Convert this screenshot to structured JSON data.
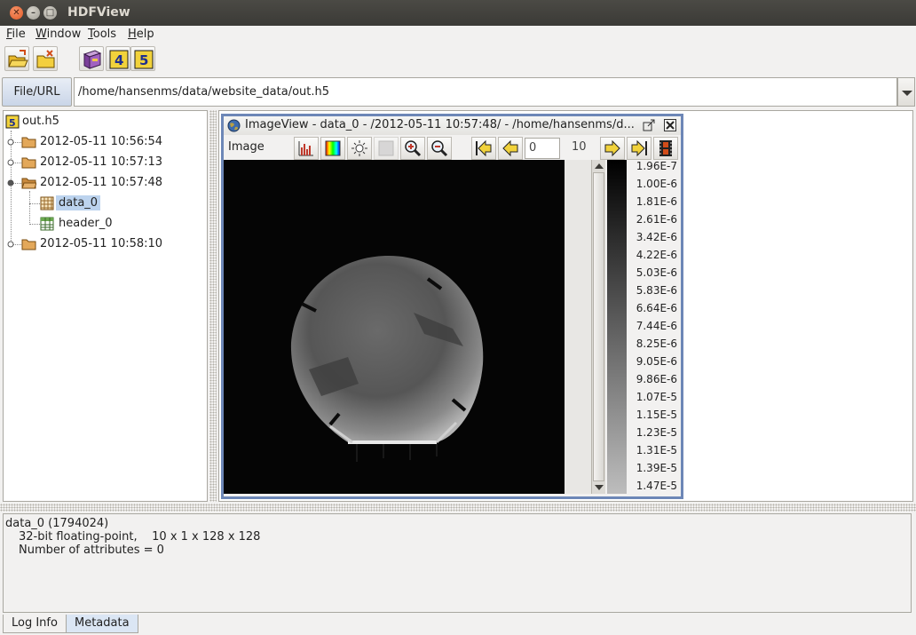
{
  "window": {
    "title": "HDFView"
  },
  "menu": [
    {
      "label": "File",
      "mnemonic": "F",
      "rest": "ile"
    },
    {
      "label": "Window",
      "mnemonic": "W",
      "rest": "indow"
    },
    {
      "label": "Tools",
      "mnemonic": "T",
      "rest": "ools"
    },
    {
      "label": "Help",
      "mnemonic": "H",
      "rest": "elp"
    }
  ],
  "toolbar": {
    "icons": [
      "open-file-icon",
      "close-file-icon",
      "users-guide-icon",
      "hdf4-library-version-icon",
      "hdf5-library-version-icon"
    ],
    "hdf4_label": "4",
    "hdf5_label": "5"
  },
  "urlbar": {
    "button_label": "File/URL",
    "value": "/home/hansenms/data/website_data/out.h5"
  },
  "tree": {
    "root": "out.h5",
    "groups": [
      {
        "label": "2012-05-11 10:56:54",
        "expanded": false
      },
      {
        "label": "2012-05-11 10:57:13",
        "expanded": false
      },
      {
        "label": "2012-05-11 10:57:48",
        "expanded": true,
        "children": [
          {
            "label": "data_0",
            "selected": true
          },
          {
            "label": "header_0",
            "selected": false
          }
        ]
      },
      {
        "label": "2012-05-11 10:58:10",
        "expanded": false
      }
    ]
  },
  "image_view": {
    "title": "ImageView  -  data_0  -  /2012-05-11 10:57:48/  -  /home/hansenms/d...",
    "menu_label": "Image",
    "frame_value": "0",
    "frame_count": "10",
    "scale_labels": [
      "1.96E-7",
      "1.00E-6",
      "1.81E-6",
      "2.61E-6",
      "3.42E-6",
      "4.22E-6",
      "5.03E-6",
      "5.83E-6",
      "6.64E-6",
      "7.44E-6",
      "8.25E-6",
      "9.05E-6",
      "9.86E-6",
      "1.07E-5",
      "1.15E-5",
      "1.23E-5",
      "1.31E-5",
      "1.39E-5",
      "1.47E-5"
    ]
  },
  "info": {
    "line1": "data_0 (1794024)",
    "line2": "32-bit floating-point,    10 x 1 x 128 x 128",
    "line3": "Number of attributes = 0"
  },
  "tabs": [
    {
      "label": "Log Info"
    },
    {
      "label": "Metadata",
      "selected": true
    }
  ],
  "colors": {
    "title_bar": "#3c3b37",
    "frame_border": "#6d87b7",
    "selection": "#bcd3ee"
  }
}
